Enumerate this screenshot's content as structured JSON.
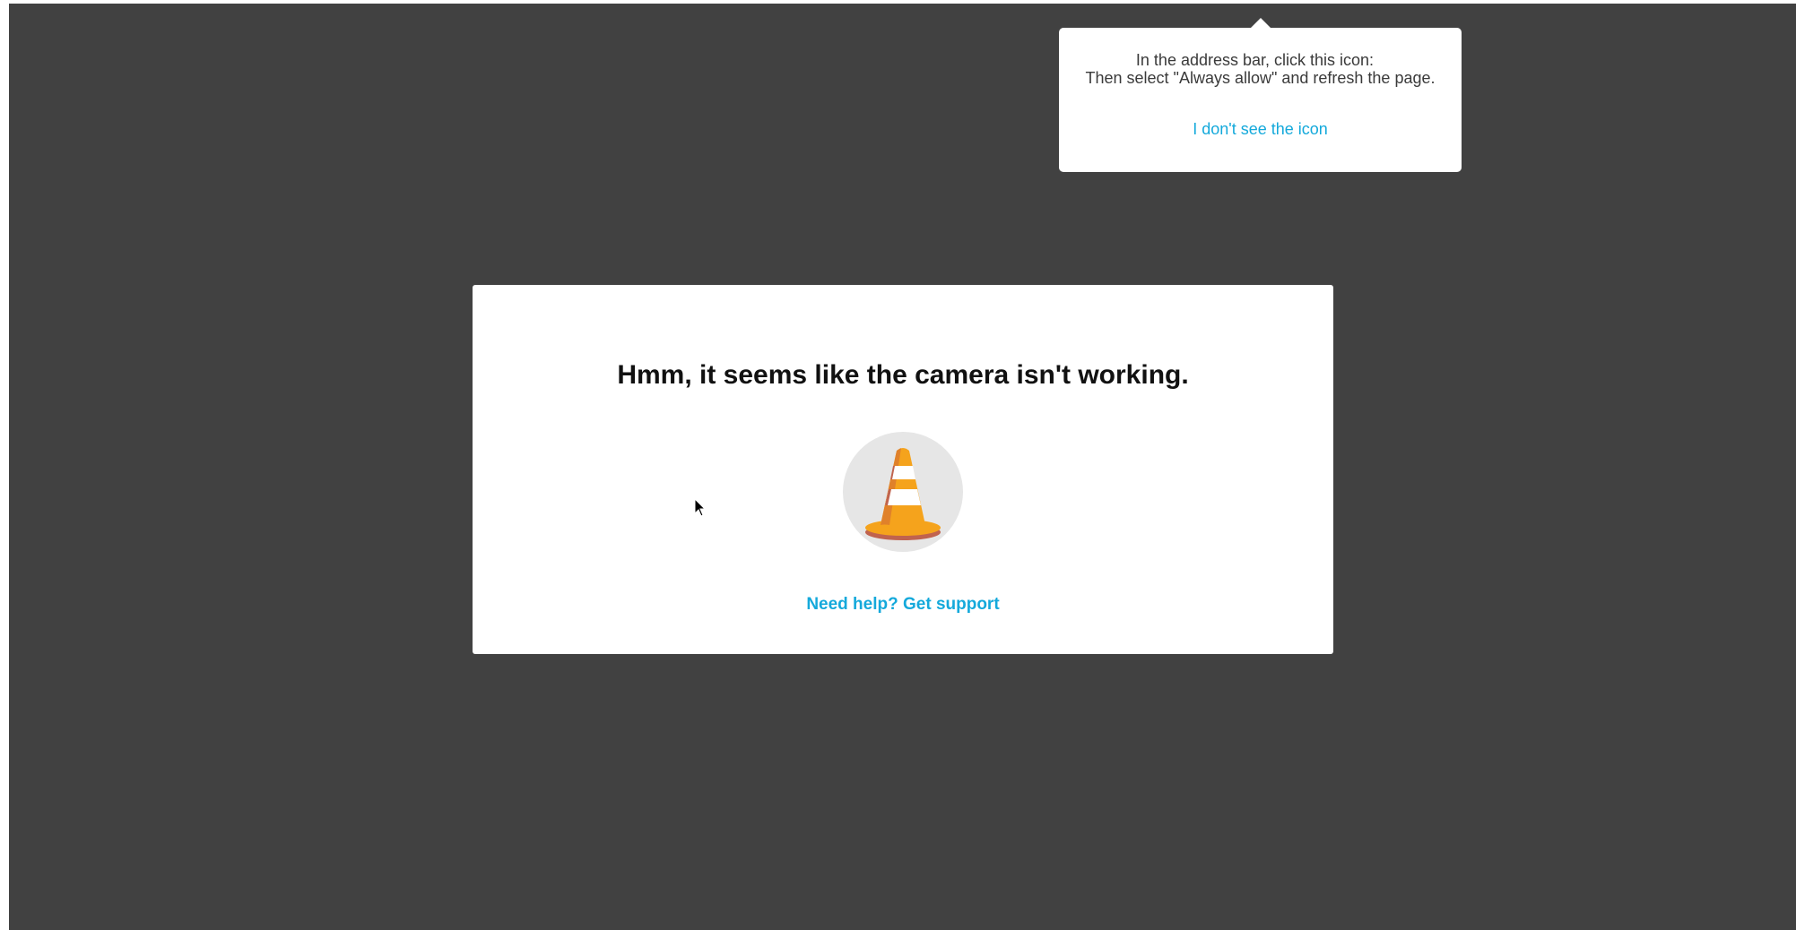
{
  "permission_tooltip": {
    "line1": "In the address bar, click this icon:",
    "line2": "Then select \"Always allow\" and refresh the page.",
    "link_label": "I don't see the icon"
  },
  "error_card": {
    "title": "Hmm, it seems like the camera isn't working.",
    "illustration_icon": "traffic-cone-icon",
    "support_link_label": "Need help? Get support"
  },
  "colors": {
    "backdrop": "#414141",
    "link": "#14a9db",
    "cone_orange": "#f5a31c",
    "cone_stripe": "#ffffff",
    "cone_base": "#c0634e",
    "illustration_circle": "#e6e6e6"
  }
}
